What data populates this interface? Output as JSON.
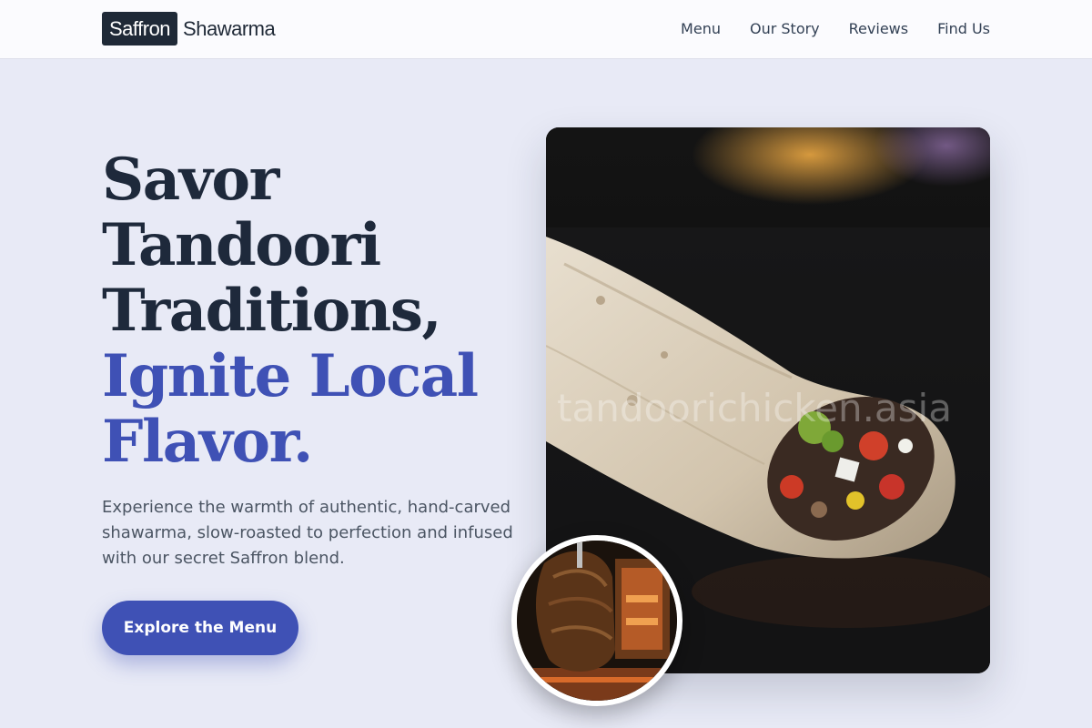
{
  "brand": {
    "logo_box": "Saffron",
    "logo_text": "Shawarma"
  },
  "nav": {
    "items": [
      "Menu",
      "Our Story",
      "Reviews",
      "Find Us"
    ]
  },
  "hero": {
    "title_dark": [
      "Savor",
      "Tandoori",
      "Traditions,"
    ],
    "title_accent": [
      "Ignite Local",
      "Flavor."
    ],
    "subtitle": "Experience the warmth of authentic, hand-carved shawarma, slow-roasted to perfection and infused with our secret Saffron blend.",
    "cta_label": "Explore the Menu"
  },
  "media": {
    "main_photo_watermark": "tandoorichicken.asia",
    "main_photo_subject": "shawarma wrap",
    "circle_photo_subject": "rotating shawarma spit"
  },
  "colors": {
    "accent": "#3f51b5",
    "heading": "#1e293b",
    "background": "#e8eaf6",
    "logo_box": "#1f2937"
  }
}
